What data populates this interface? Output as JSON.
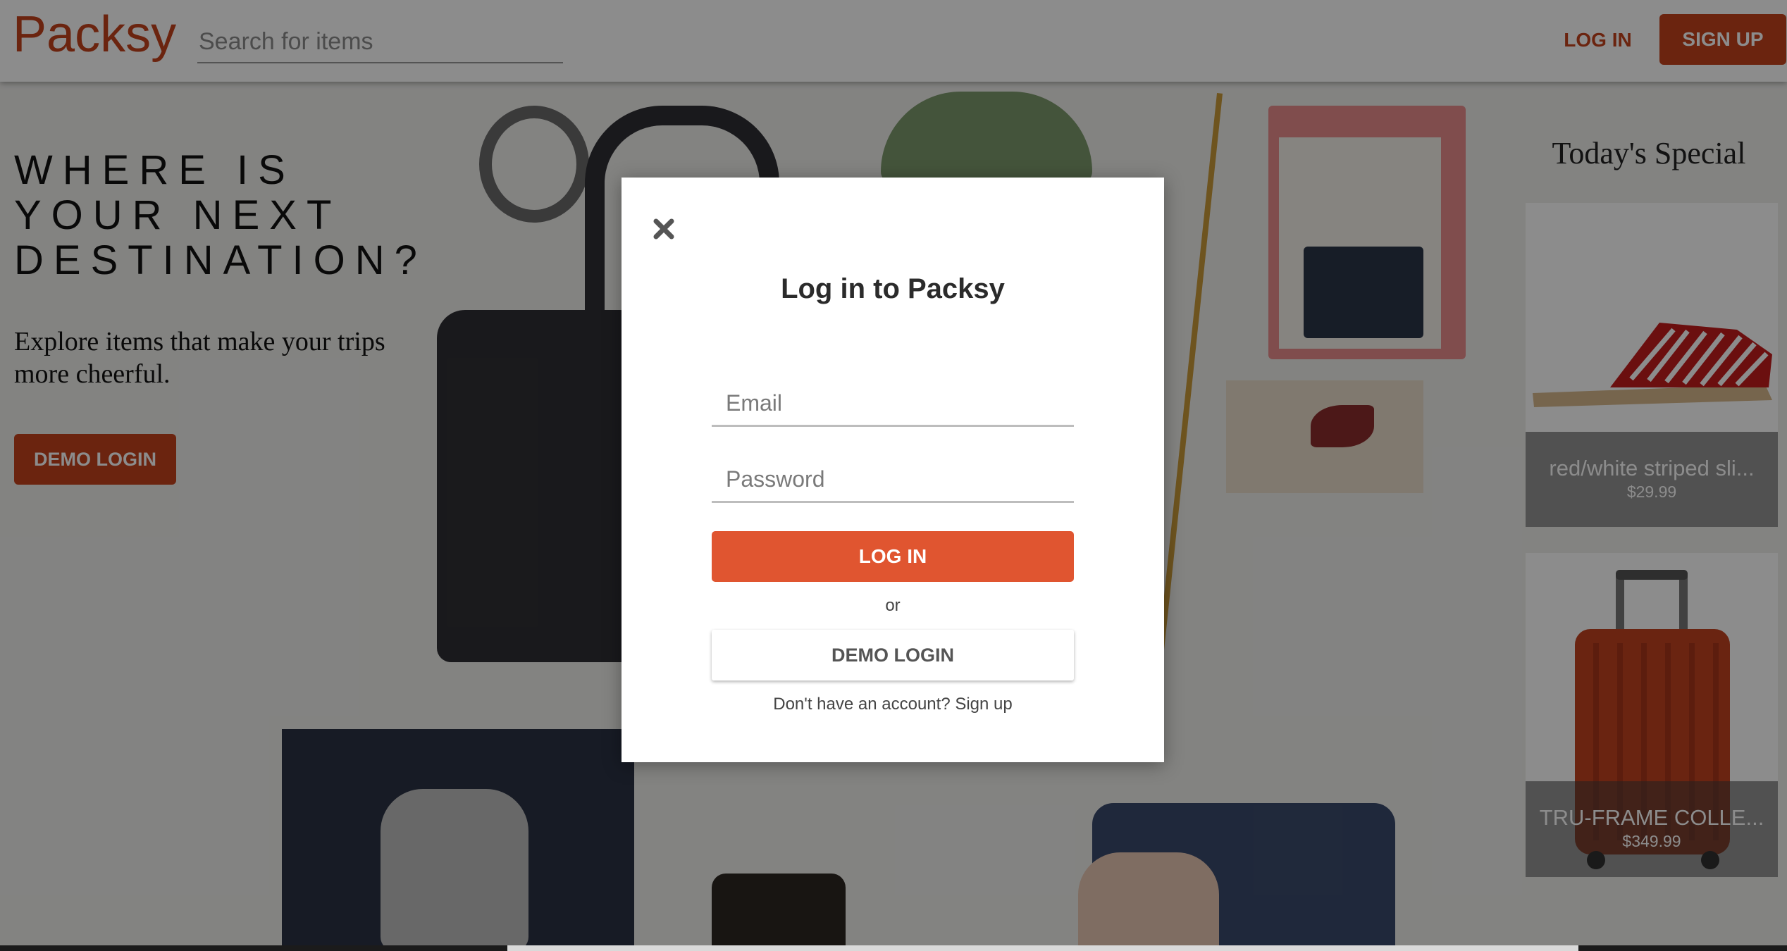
{
  "header": {
    "logo": "Packsy",
    "search_placeholder": "Search for items",
    "login_label": "LOG IN",
    "signup_label": "SIGN UP"
  },
  "hero": {
    "title": "WHERE IS YOUR NEXT DESTINATION?",
    "subtitle": "Explore items that make your trips more cheerful.",
    "demo_label": "DEMO LOGIN"
  },
  "special": {
    "title": "Today's Special",
    "items": [
      {
        "name": "red/white striped sli...",
        "price": "$29.99"
      },
      {
        "name": "TRU-FRAME COLLE...",
        "price": "$349.99"
      }
    ]
  },
  "modal": {
    "title": "Log in to Packsy",
    "email_placeholder": "Email",
    "password_placeholder": "Password",
    "login_label": "LOG IN",
    "or_text": "or",
    "demo_label": "DEMO LOGIN",
    "signup_prompt": "Don't have an account?",
    "signup_link": "Sign up"
  },
  "colors": {
    "brand": "#c4421d",
    "modal_login_button": "#e05530"
  },
  "icons": {
    "close": "close-icon"
  }
}
